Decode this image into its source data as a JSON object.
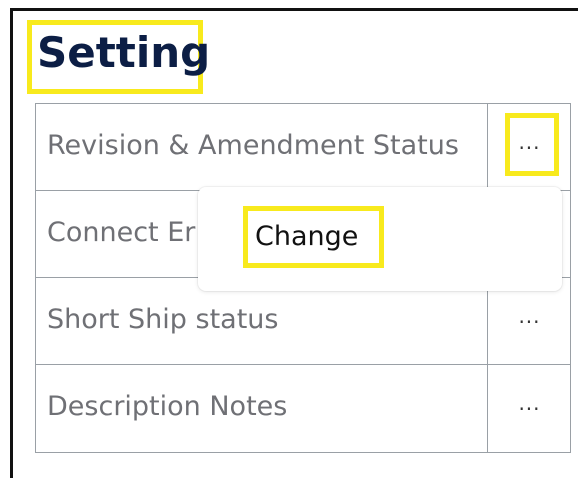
{
  "page": {
    "title": "Setting"
  },
  "settings": {
    "rows": [
      {
        "label": "Revision & Amendment Status",
        "more_label": "···"
      },
      {
        "label": "Connect Er",
        "more_label": ""
      },
      {
        "label": "Short Ship status",
        "more_label": "···"
      },
      {
        "label": "Description Notes",
        "more_label": "···"
      }
    ]
  },
  "menu": {
    "item_change": "Change"
  },
  "colors": {
    "highlight": "#f8ea1d",
    "title": "#0c1e45",
    "label": "#6f7075",
    "border": "#9aa0a6"
  },
  "icons": {
    "more": "ellipsis-icon"
  }
}
